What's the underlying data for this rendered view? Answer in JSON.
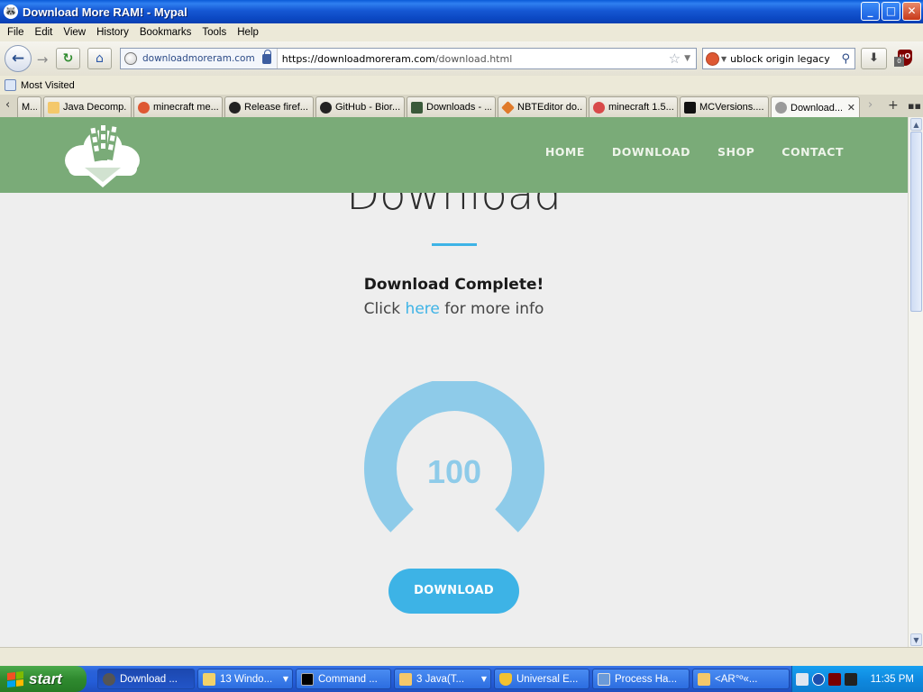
{
  "window": {
    "title": "Download More RAM! - Mypal",
    "buttons": {
      "minimize": "_",
      "maximize": "□",
      "close": "✕"
    }
  },
  "menu": [
    "File",
    "Edit",
    "View",
    "History",
    "Bookmarks",
    "Tools",
    "Help"
  ],
  "nav": {
    "site_identity": "downloadmoreram.com",
    "url_host": "https://downloadmoreram.com",
    "url_path": "/download.html",
    "search_value": "ublock origin legacy",
    "ublock_count": "0"
  },
  "bookmarks": {
    "most_visited": "Most Visited"
  },
  "tabs": [
    {
      "label": "M...",
      "icon": "page-icon",
      "color": "#e8e8e8"
    },
    {
      "label": "Java Decomp...",
      "icon": "java-icon",
      "color": "#f4c86a"
    },
    {
      "label": "minecraft me...",
      "icon": "duckduckgo-icon",
      "color": "#de5833"
    },
    {
      "label": "Release firef...",
      "icon": "github-icon",
      "color": "#222222"
    },
    {
      "label": "GitHub - Bior...",
      "icon": "github-icon",
      "color": "#222222"
    },
    {
      "label": "Downloads - ...",
      "icon": "terminal-icon",
      "color": "#3a5a3a"
    },
    {
      "label": "NBTEditor do...",
      "icon": "nbt-icon",
      "color": "#e07a2a"
    },
    {
      "label": "minecraft 1.5...",
      "icon": "minecraft-icon",
      "color": "#d84a4a"
    },
    {
      "label": "MCVersions....",
      "icon": "mcversions-icon",
      "color": "#111111"
    },
    {
      "label": "Download...",
      "icon": "globe-icon",
      "color": "#9a9a9a",
      "active": true
    }
  ],
  "site": {
    "nav": [
      "HOME",
      "DOWNLOAD",
      "SHOP",
      "CONTACT"
    ],
    "heading": "Download",
    "complete": "Download Complete!",
    "info_prefix": "Click ",
    "info_link": "here",
    "info_suffix": " for more info",
    "progress_value": "100",
    "progress_fraction": 1.0,
    "button": "DOWNLOAD",
    "colors": {
      "header": "#7aab78",
      "accent": "#3db3e6",
      "gauge": "#8ecbe9"
    }
  },
  "taskbar": {
    "start": "start",
    "tasks": [
      {
        "label": "Download ...",
        "icon": "mypal-icon",
        "color": "#555555",
        "active": true
      },
      {
        "label": "13 Windo...",
        "icon": "folder-icon",
        "color": "#f2d26a",
        "dropdown": true
      },
      {
        "label": "Command ...",
        "icon": "cmd-icon",
        "color": "#000000"
      },
      {
        "label": "3 Java(T...",
        "icon": "java-icon",
        "color": "#f4c86a",
        "dropdown": true
      },
      {
        "label": "Universal E...",
        "icon": "shield-icon",
        "color": "#f2c230"
      },
      {
        "label": "Process Ha...",
        "icon": "monitor-icon",
        "color": "#6a9ad8"
      },
      {
        "label": "<AR°º«...",
        "icon": "java-icon",
        "color": "#f4c86a"
      }
    ],
    "clock": "11:35 PM"
  }
}
